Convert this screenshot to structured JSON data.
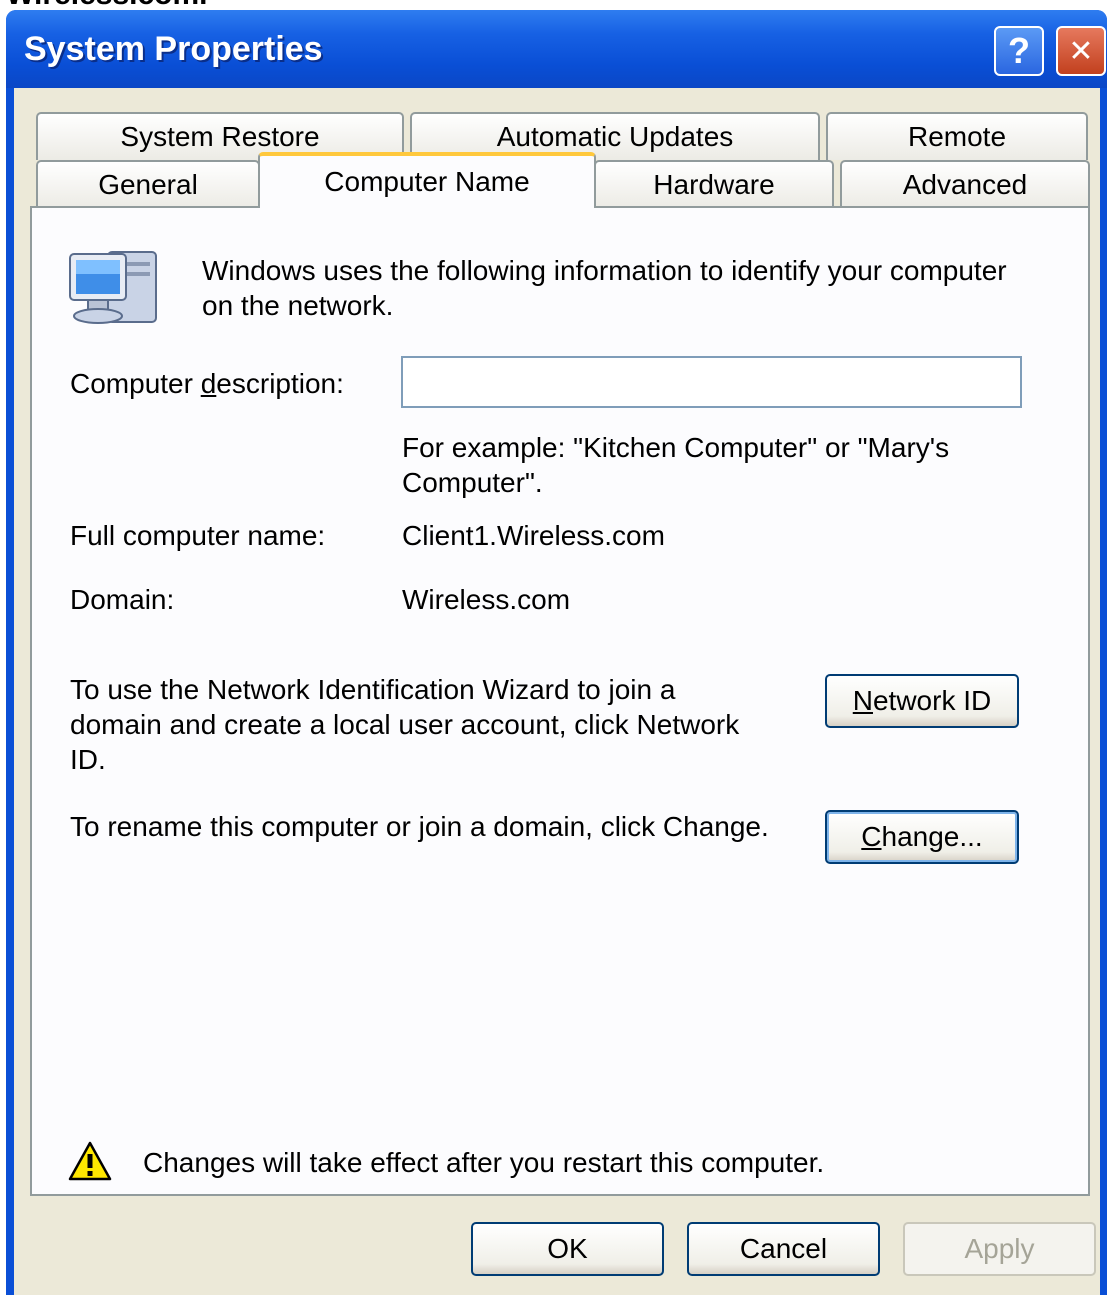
{
  "page_header_fragment": "Wireless.com.",
  "window": {
    "title": "System Properties",
    "help_glyph": "?",
    "close_glyph": "✕"
  },
  "tabs": {
    "row_back": [
      {
        "label": "System Restore"
      },
      {
        "label": "Automatic Updates"
      },
      {
        "label": "Remote"
      }
    ],
    "row_front": [
      {
        "label": "General"
      },
      {
        "label": "Computer Name",
        "active": true
      },
      {
        "label": "Hardware"
      },
      {
        "label": "Advanced"
      }
    ]
  },
  "content": {
    "intro_line1": "Windows uses the following information to identify your computer",
    "intro_line2": "on the network.",
    "description_label_pre": "Computer ",
    "description_label_accel": "d",
    "description_label_post": "escription:",
    "description_value": "",
    "example_line1": "For example: \"Kitchen Computer\" or \"Mary's",
    "example_line2": "Computer\".",
    "full_name_label": "Full computer name:",
    "full_name_value": "Client1.Wireless.com",
    "domain_label": "Domain:",
    "domain_value": "Wireless.com",
    "wizard_line1": "To use the Network Identification Wizard to join a",
    "wizard_line2": "domain and create a local user account, click Network",
    "wizard_line3": "ID.",
    "network_id_accel": "N",
    "network_id_rest": "etwork ID",
    "rename_text": "To rename this computer or join a domain, click Change.",
    "change_accel": "C",
    "change_rest": "hange...",
    "warning_text": "Changes will take effect after you restart this computer."
  },
  "icons": {
    "computer": "computer-icon",
    "warning": "warning-icon"
  },
  "footer": {
    "ok_label": "OK",
    "cancel_label": "Cancel",
    "apply_label": "Apply"
  },
  "colors": {
    "titlebar": "#0a4fd6",
    "dialog_bg": "#ece9d8",
    "active_tab_accent": "#ffc83c",
    "button_border": "#003c74"
  }
}
